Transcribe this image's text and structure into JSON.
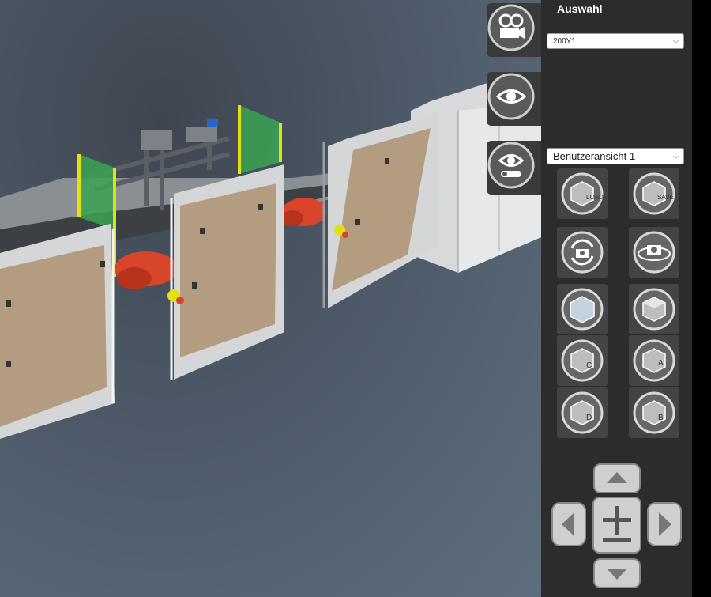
{
  "panel": {
    "title": "Auswahl",
    "selection_value": "200Y1",
    "view_value": "Benutzeransicht 1"
  },
  "view_buttons": {
    "load": "LOAD",
    "save": "SAVE",
    "c": "C",
    "a": "A",
    "d": "D",
    "b": "B"
  },
  "colors": {
    "panel_bg": "#2c2c2c",
    "button_bg": "#444444",
    "accent_yellow": "#e6df12",
    "motor_red": "#d8452a"
  }
}
